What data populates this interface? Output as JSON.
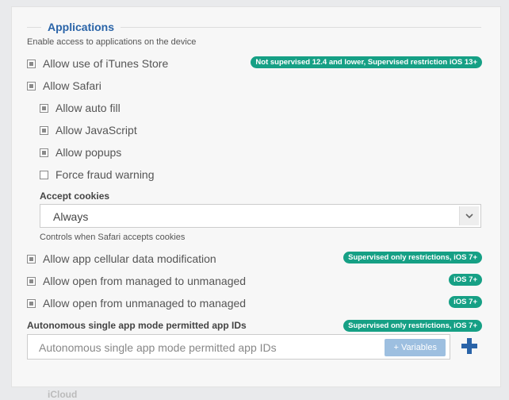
{
  "section": {
    "title": "Applications",
    "description": "Enable access to applications on the device"
  },
  "options": [
    {
      "label": "Allow use of iTunes Store",
      "checked": true
    },
    {
      "label": "Allow Safari",
      "checked": true
    },
    {
      "label": "Allow auto fill",
      "checked": true
    },
    {
      "label": "Allow JavaScript",
      "checked": true
    },
    {
      "label": "Allow popups",
      "checked": true
    },
    {
      "label": "Force fraud warning",
      "checked": false
    },
    {
      "label": "Allow app cellular data modification",
      "checked": true
    },
    {
      "label": "Allow open from managed to unmanaged",
      "checked": true
    },
    {
      "label": "Allow open from unmanaged to managed",
      "checked": true
    }
  ],
  "badges": {
    "itunes": "Not supervised 12.4 and lower, Supervised restriction iOS 13+",
    "cellular": "Supervised only restrictions, iOS 7+",
    "managed_to_unmanaged": "iOS 7+",
    "unmanaged_to_managed": "iOS 7+",
    "autonomous": "Supervised only restrictions, iOS 7+"
  },
  "cookies": {
    "label": "Accept cookies",
    "value": "Always",
    "hint": "Controls when Safari accepts cookies"
  },
  "autonomous": {
    "label": "Autonomous single app mode permitted app IDs",
    "placeholder": "Autonomous single app mode permitted app IDs",
    "variables_button": "+ Variables"
  },
  "next_section_cut": "iCloud",
  "colors": {
    "accent": "#2a64a8",
    "badge": "#16a085",
    "plus": "#2a64a8"
  }
}
